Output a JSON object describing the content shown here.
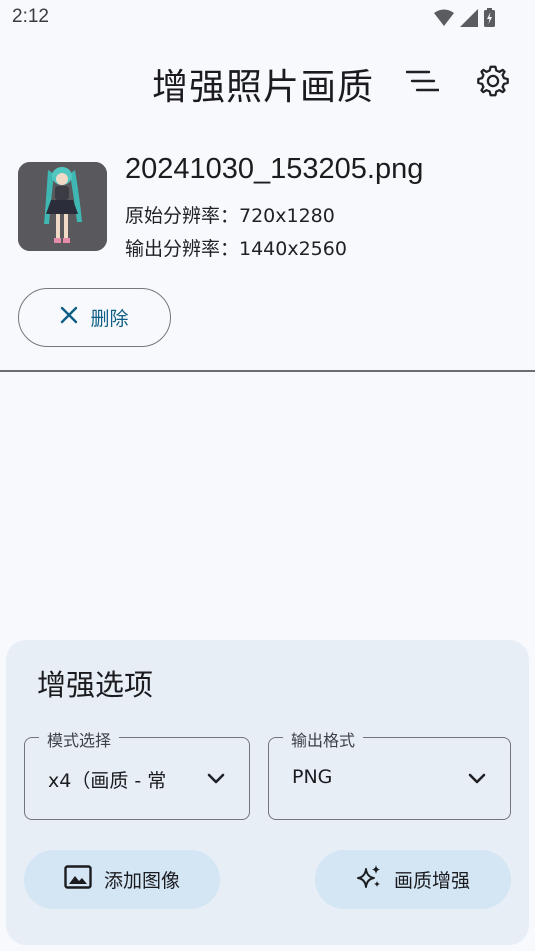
{
  "status_bar": {
    "time": "2:12",
    "icons": [
      "wifi-icon",
      "cell-signal-icon",
      "battery-charging-icon"
    ]
  },
  "header": {
    "title": "增强照片画质",
    "sort_icon": "sort-lines-icon",
    "settings_icon": "gear-icon"
  },
  "file": {
    "name": "20241030_153205.png",
    "original_resolution": "原始分辨率：720x1280",
    "output_resolution": "输出分辨率：1440x2560"
  },
  "delete_button": {
    "label": "删除",
    "icon": "close-icon"
  },
  "options": {
    "title": "增强选项",
    "mode": {
      "label": "模式选择",
      "value": "x4（画质 - 常"
    },
    "format": {
      "label": "输出格式",
      "value": "PNG"
    }
  },
  "actions": {
    "add_image": {
      "label": "添加图像",
      "icon": "image-icon"
    },
    "enhance": {
      "label": "画质增强",
      "icon": "sparkle-icon"
    }
  },
  "colors": {
    "background": "#f8f9fc",
    "panel": "#e7eef6",
    "tonal_button": "#d4e5f4",
    "accent": "#0e5f85"
  }
}
